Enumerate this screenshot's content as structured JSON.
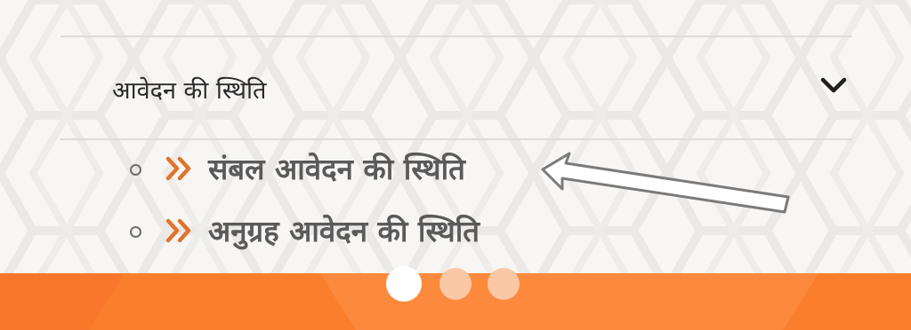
{
  "accordion": {
    "title": "आवेदन की स्थिति",
    "chevron_icon": "chevron-down-icon",
    "expanded": true
  },
  "status_links": [
    {
      "label": "संबल आवेदन की स्थिति",
      "icon": "double-chevron-right-icon"
    },
    {
      "label": "अनुग्रह आवेदन की स्थिति",
      "icon": "double-chevron-right-icon"
    }
  ],
  "annotation": {
    "icon": "arrow-left-icon"
  },
  "carousel": {
    "total": 3,
    "active": 1
  },
  "colors": {
    "accent": "#e0742a",
    "footer": "#fb7e2d",
    "text_dark": "#2a2a2a",
    "text_link": "#5a5a5a"
  }
}
